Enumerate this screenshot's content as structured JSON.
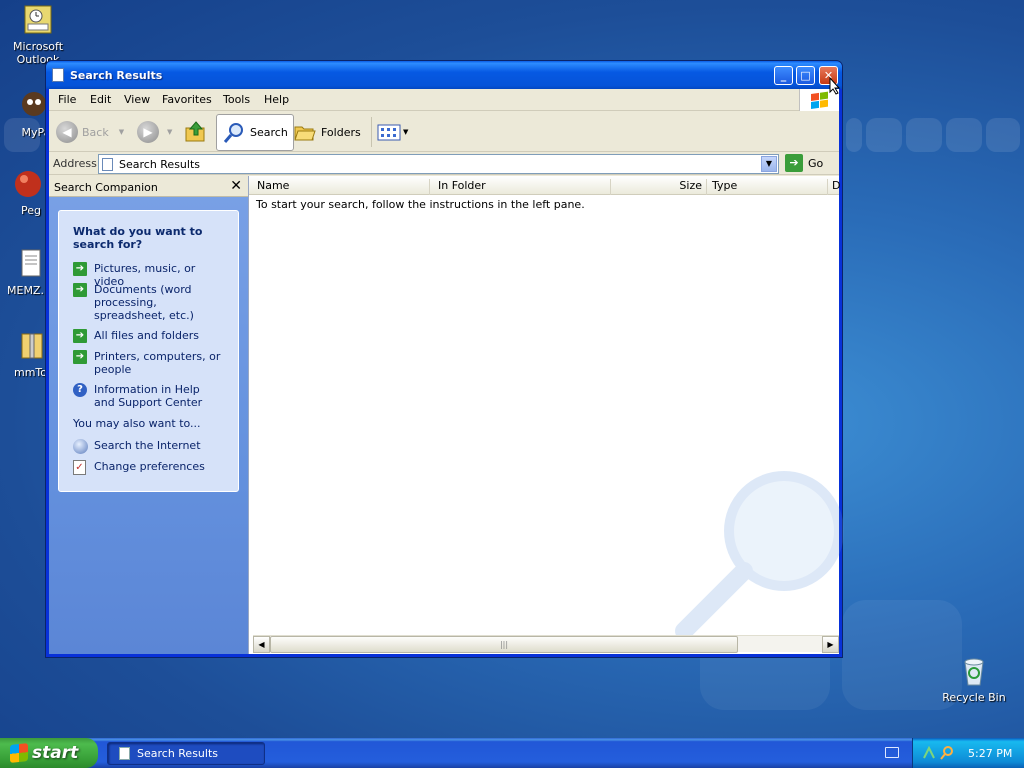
{
  "desktop": {
    "icons": [
      {
        "label": "Microsoft Outlook"
      },
      {
        "label": "MyPa"
      },
      {
        "label": "Peg"
      },
      {
        "label": "MEMZ."
      },
      {
        "label": "mmTo"
      }
    ],
    "recycle_bin": "Recycle Bin"
  },
  "window": {
    "title": "Search Results",
    "buttons": {
      "minimize": "_",
      "maximize": "□",
      "close": "✕"
    }
  },
  "menu": [
    "File",
    "Edit",
    "View",
    "Favorites",
    "Tools",
    "Help"
  ],
  "toolbar": {
    "back": "Back",
    "search": "Search",
    "folders": "Folders"
  },
  "address": {
    "label": "Address",
    "value": "Search Results",
    "go": "Go"
  },
  "search_companion": {
    "title": "Search Companion",
    "close": "✕",
    "question": "What do you want to search for?",
    "options": [
      {
        "label": "Pictures, music, or video",
        "icon": "green-arrow-icon"
      },
      {
        "label": "Documents (word processing, spreadsheet, etc.)",
        "icon": "green-arrow-icon"
      },
      {
        "label": "All files and folders",
        "icon": "green-arrow-icon"
      },
      {
        "label": "Printers, computers, or people",
        "icon": "green-arrow-icon"
      },
      {
        "label": "Information in Help and Support Center",
        "icon": "help-icon"
      }
    ],
    "also_label": "You may also want to...",
    "also_options": [
      {
        "label": "Search the Internet",
        "icon": "globe-search-icon"
      },
      {
        "label": "Change preferences",
        "icon": "preferences-icon"
      }
    ]
  },
  "results": {
    "columns": [
      "Name",
      "In Folder",
      "Size",
      "Type",
      "D"
    ],
    "message": "To start your search, follow the instructions in the left pane."
  },
  "taskbar": {
    "start": "start",
    "tasks": [
      {
        "label": "Search Results"
      }
    ],
    "clock": "5:27 PM"
  },
  "colors": {
    "titlebar": "#0659e3",
    "start_green": "#3c9a3c",
    "pane_blue": "#6491de"
  }
}
